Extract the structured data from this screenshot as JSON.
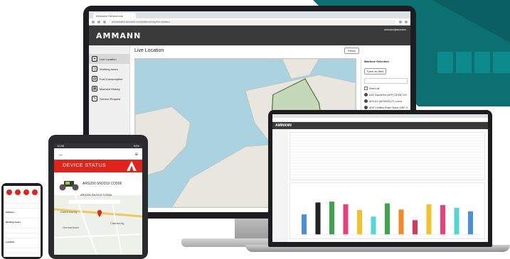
{
  "monitor": {
    "browser": {
      "tab_title": "Ammann ServiceLink",
      "url": "ammannlink.ammann.com/platform/map/live-location"
    },
    "app": {
      "logo": "AMMANN",
      "user": "ammann@ammann"
    },
    "sidebar": {
      "items": [
        {
          "label": "Live Location",
          "icon": "pin-icon"
        },
        {
          "label": "Working hours",
          "icon": "clock-icon"
        },
        {
          "label": "Fuel Consumption",
          "icon": "fuel-icon"
        },
        {
          "label": "Machine History",
          "icon": "history-icon"
        },
        {
          "label": "Service Request",
          "icon": "wrench-icon"
        }
      ]
    },
    "main": {
      "title": "Live Location",
      "filters_label": "Filters"
    },
    "right_panel": {
      "title": "Machine Selection",
      "save_label": "Save as filter",
      "select_all": "Select all",
      "machines": [
        "AXE DazzleHot (APP) DE/BE 10V",
        "ARX110 (AE03400) PL Lucca",
        "ARP Certified Roller Stand (ARP-9"
      ]
    }
  },
  "laptop": {
    "logo": "AMMANN",
    "chart_bar_colors": [
      "#4a90d9",
      "#222222",
      "#3fa34d",
      "#e8407a",
      "#f2c12e",
      "#55d6d6",
      "#3fa34d",
      "#f08a24",
      "#d23a5a",
      "#f2c12e",
      "#e8407a",
      "#55d6d6",
      "#4a90d9"
    ],
    "chart_bar_values": [
      0.45,
      0.72,
      0.74,
      0.68,
      0.55,
      0.4,
      0.7,
      0.56,
      0.32,
      0.68,
      0.66,
      0.6,
      0.52
    ]
  },
  "tablet": {
    "status_left": "10:30",
    "status_right": "94%",
    "banner": "DEVICE STATUS",
    "serial": "ARS200 SN2019 CO506",
    "map_label": "ARS200 SN2019 CO506",
    "places": [
      "Gaithersburg",
      "Clarksburg",
      "Germantown"
    ]
  },
  "phone": {
    "sections": [
      "Address",
      "Working hours",
      "Location"
    ]
  }
}
